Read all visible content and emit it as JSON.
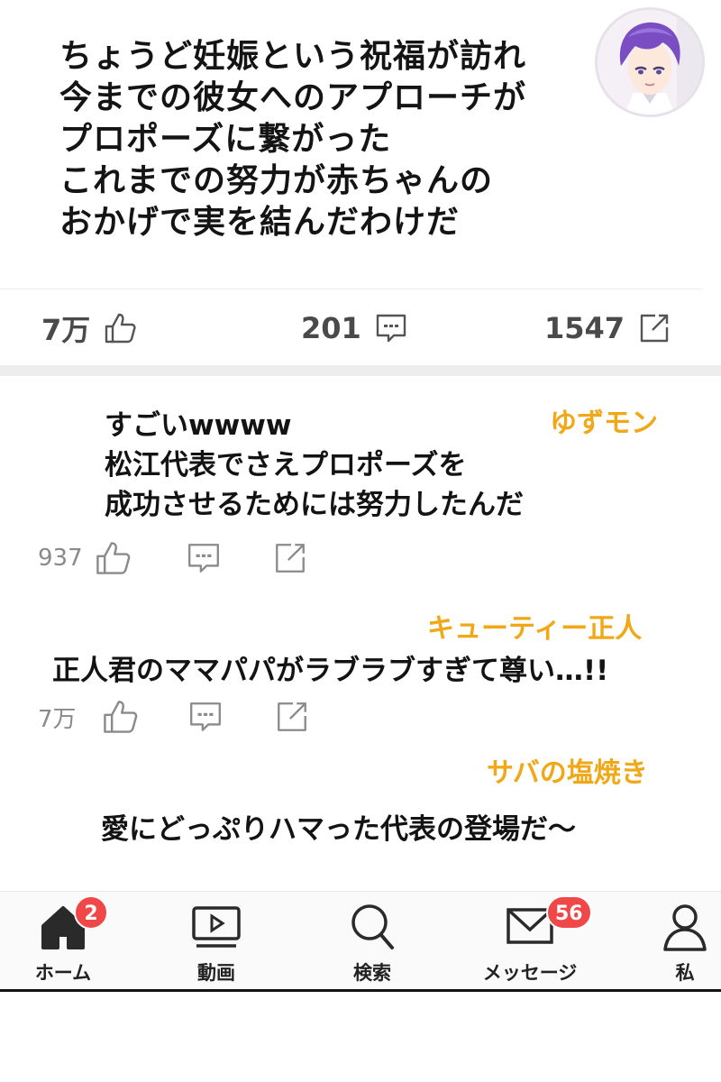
{
  "post": {
    "lines": [
      "ちょうど妊娠という祝福が訪れ",
      "今までの彼女へのアプローチが",
      "プロポーズに繋がった",
      "これまでの努力が赤ちゃんの",
      "おかげで実を結んだわけだ"
    ],
    "likes": "7万",
    "comments": "201",
    "shares": "1547"
  },
  "comments": [
    {
      "author": "ゆずモン",
      "lines": [
        "すごいwwww",
        "松江代表でさえプロポーズを",
        "成功させるためには努力したんだ"
      ],
      "likes": "937"
    },
    {
      "author": "キューティー正人",
      "lines": [
        "正人君のママパパがラブラブすぎて尊い…!!"
      ],
      "likes": "7万"
    },
    {
      "author": "サバの塩焼き",
      "lines": [
        "愛にどっぷりハマった代表の登場だ～"
      ]
    }
  ],
  "nav": {
    "items": [
      {
        "label": "ホーム",
        "icon": "home-icon",
        "badge": "2"
      },
      {
        "label": "動画",
        "icon": "video-icon"
      },
      {
        "label": "検索",
        "icon": "search-icon"
      },
      {
        "label": "メッセージ",
        "icon": "mail-icon",
        "badge": "56"
      },
      {
        "label": "私",
        "icon": "person-icon"
      }
    ]
  },
  "colors": {
    "author": "#f0a817",
    "badge": "#f04848",
    "icon_gray": "#8a8a8a"
  }
}
